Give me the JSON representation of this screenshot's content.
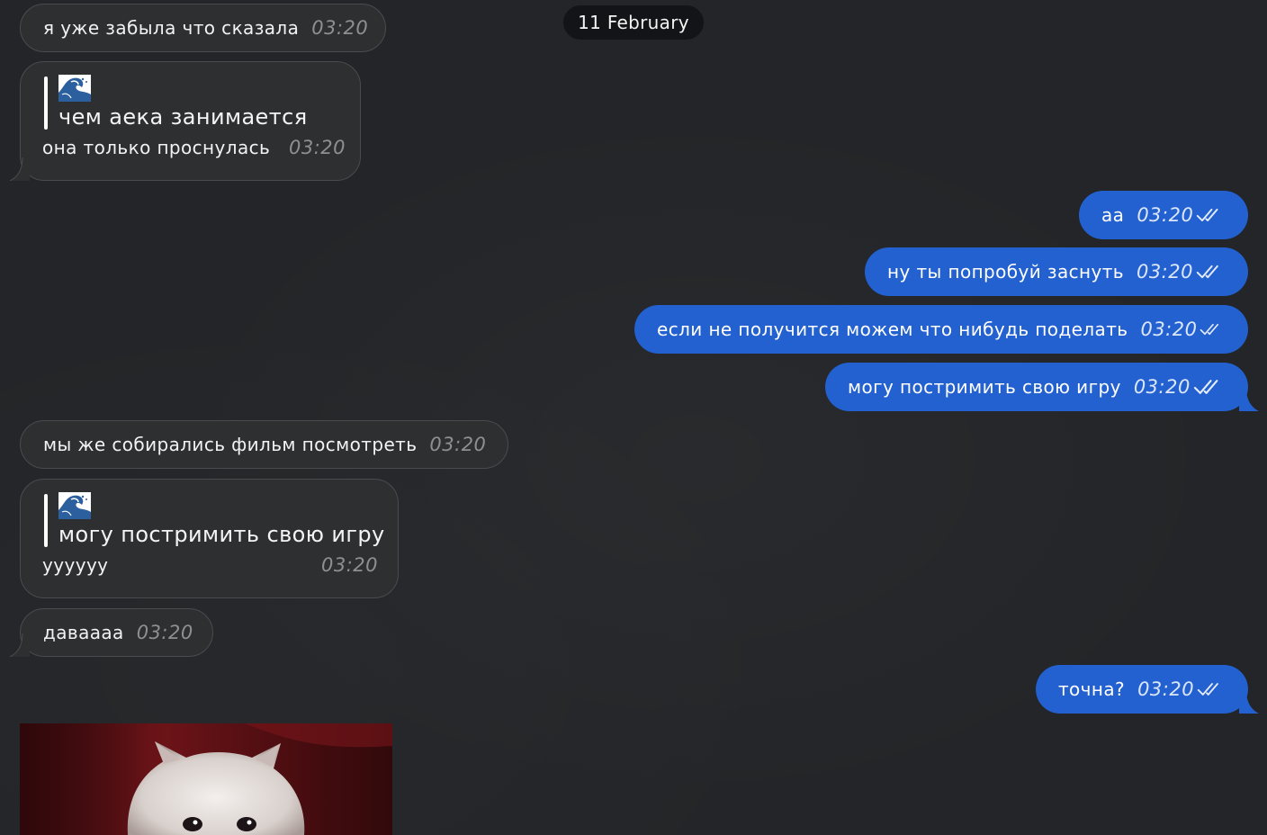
{
  "date_divider": "11 February",
  "colors": {
    "background": "#232528",
    "incoming_bubble": "#2e2f31",
    "outgoing_bubble": "#2361d0",
    "date_pill": "#131417"
  },
  "messages": {
    "m1": {
      "text": "я уже забыла что сказала",
      "time": "03:20"
    },
    "m2": {
      "reply_icon": "wave-emoji",
      "reply_text": "чем аека занимается",
      "text": "она только проснулась",
      "time": "03:20"
    },
    "m3": {
      "text": "аа",
      "time": "03:20",
      "status_icon": "double-check-icon"
    },
    "m4": {
      "text": "ну ты попробуй заснуть",
      "time": "03:20",
      "status_icon": "double-check-icon"
    },
    "m5": {
      "text": "если не получится можем что нибудь поделать",
      "time": "03:20",
      "status_icon": "double-check-icon"
    },
    "m6": {
      "text": "могу постримить свою игру",
      "time": "03:20",
      "status_icon": "double-check-icon"
    },
    "m7": {
      "text": "мы же собирались фильм посмотреть",
      "time": "03:20"
    },
    "m8": {
      "reply_icon": "wave-emoji",
      "reply_text": "могу постримить свою игру",
      "text": "уууууу",
      "time": "03:20"
    },
    "m9": {
      "text": "даваааа",
      "time": "03:20"
    },
    "m10": {
      "text": "точна?",
      "time": "03:20",
      "status_icon": "double-check-icon"
    }
  },
  "photo": {
    "subject": "white kitten on red background"
  }
}
